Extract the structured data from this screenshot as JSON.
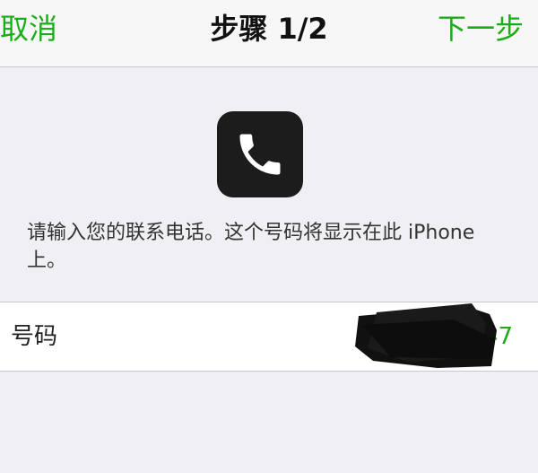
{
  "navbar": {
    "cancel_label": "取消",
    "title": "步骤 1/2",
    "next_label": "下一步"
  },
  "icon": {
    "name": "phone-icon",
    "background": "#1c1c1c",
    "glyph_color": "#ffffff"
  },
  "description": "请输入您的联系电话。这个号码将显示在此 iPhone 上。",
  "number_field": {
    "label": "号码",
    "value": "1        47"
  },
  "colors": {
    "accent": "#1aad19",
    "background": "#efeff4",
    "navbar": "#f7f7f7",
    "separator": "#c8c7cc"
  }
}
